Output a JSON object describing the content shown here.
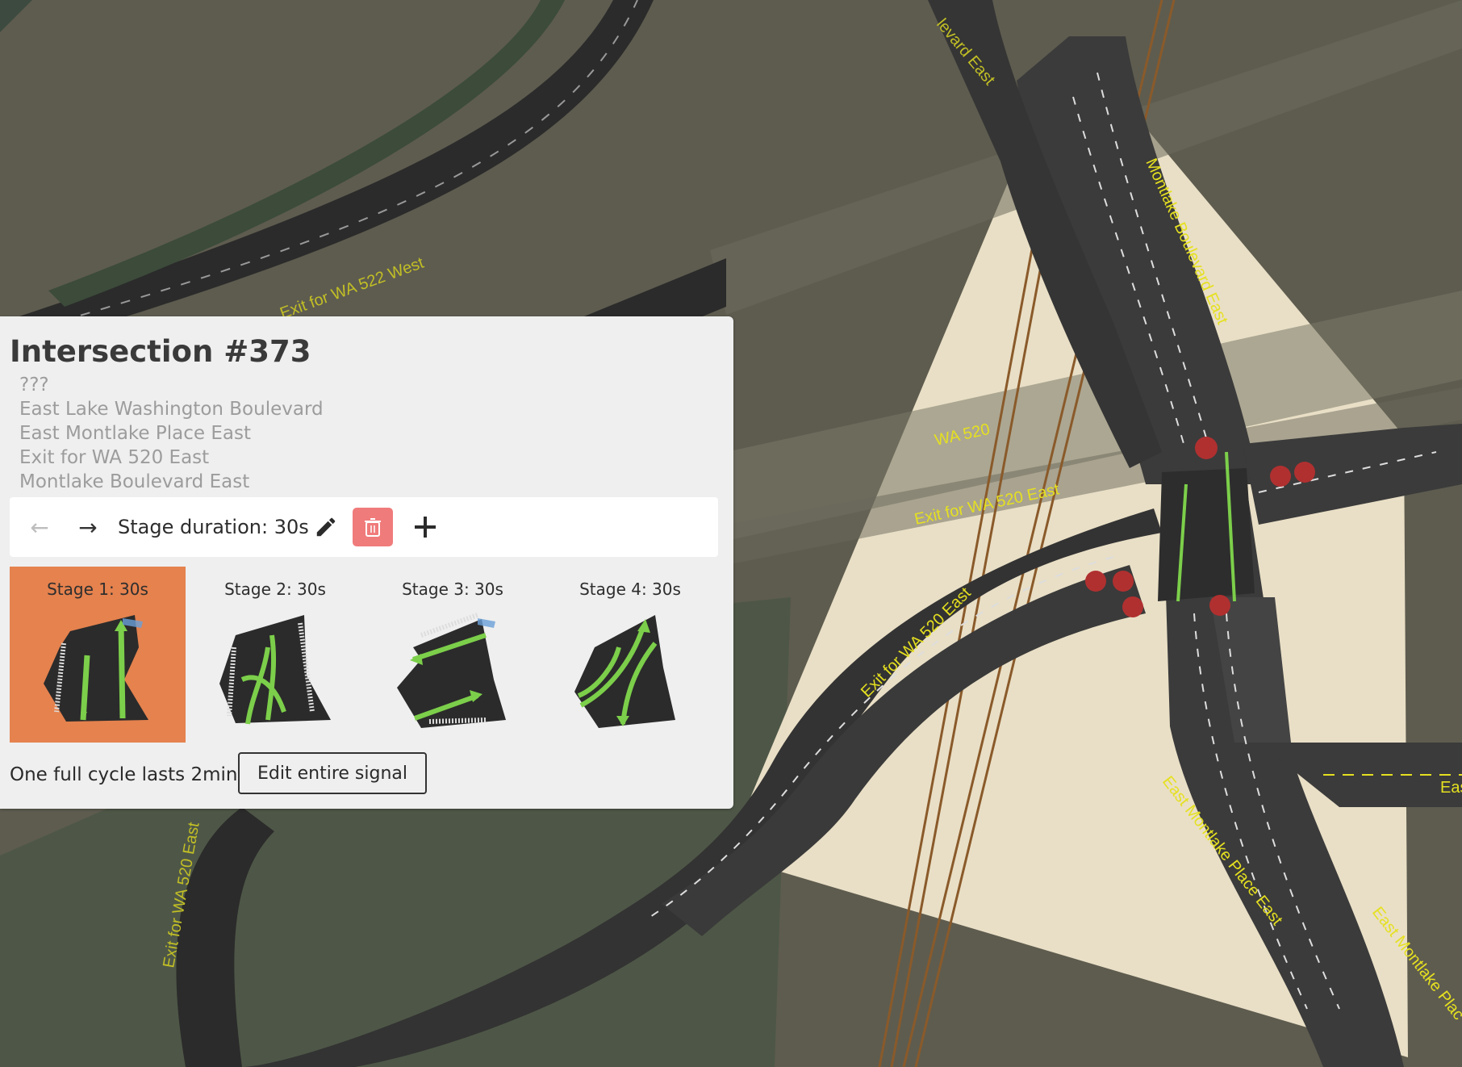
{
  "panel": {
    "title": "Intersection #373",
    "roads": [
      "???",
      "East Lake Washington Boulevard",
      "East Montlake Place East",
      "Exit for WA 520 East",
      "Montlake Boulevard East"
    ],
    "toolbar": {
      "prev_label": "←",
      "next_label": "→",
      "duration_label": "Stage duration: 30s",
      "edit_icon": "pencil-icon",
      "delete_icon": "trash-icon",
      "add_icon": "plus-icon"
    },
    "stages": [
      {
        "label": "Stage 1: 30s",
        "active": true
      },
      {
        "label": "Stage 2: 30s",
        "active": false
      },
      {
        "label": "Stage 3: 30s",
        "active": false
      },
      {
        "label": "Stage 4: 30s",
        "active": false
      }
    ],
    "cycle_text": "One full cycle lasts 2min",
    "edit_signal_label": "Edit entire signal"
  },
  "map_labels": {
    "road1": "Exit for WA 522 West",
    "road2": "Montlake Boulevard East",
    "road3": "WA 520",
    "road4": "Exit for WA 520 East",
    "road5": "Exit for WA 520 East",
    "road6": "East Montlake Place East",
    "road7": "East Montlake Plac",
    "road8": "Exit for WA 520 East",
    "road9": "levard East",
    "road10": "Eas"
  },
  "colors": {
    "ground": "#5e5c4f",
    "road": "#2f2f2f",
    "highlight": "#f0e6cc",
    "label": "#e5e020",
    "stage_active": "#e5824e",
    "delete_button": "#f07b7b",
    "movement": "#7ccf4a"
  }
}
